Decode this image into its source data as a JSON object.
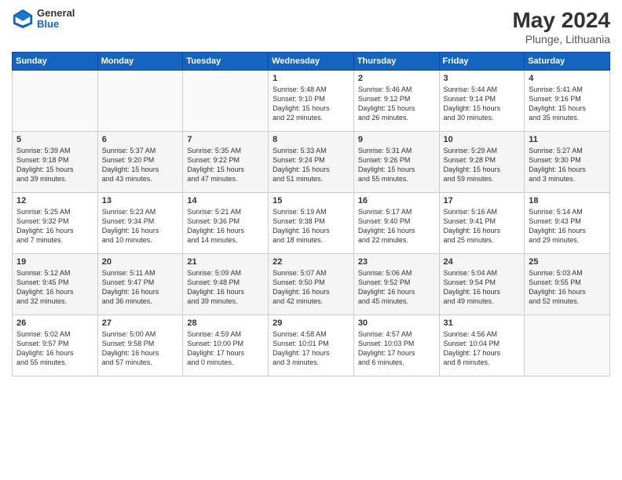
{
  "header": {
    "logo_general": "General",
    "logo_blue": "Blue",
    "month": "May 2024",
    "location": "Plunge, Lithuania"
  },
  "weekdays": [
    "Sunday",
    "Monday",
    "Tuesday",
    "Wednesday",
    "Thursday",
    "Friday",
    "Saturday"
  ],
  "weeks": [
    [
      {
        "day": "",
        "info": ""
      },
      {
        "day": "",
        "info": ""
      },
      {
        "day": "",
        "info": ""
      },
      {
        "day": "1",
        "info": "Sunrise: 5:48 AM\nSunset: 9:10 PM\nDaylight: 15 hours\nand 22 minutes."
      },
      {
        "day": "2",
        "info": "Sunrise: 5:46 AM\nSunset: 9:12 PM\nDaylight: 15 hours\nand 26 minutes."
      },
      {
        "day": "3",
        "info": "Sunrise: 5:44 AM\nSunset: 9:14 PM\nDaylight: 15 hours\nand 30 minutes."
      },
      {
        "day": "4",
        "info": "Sunrise: 5:41 AM\nSunset: 9:16 PM\nDaylight: 15 hours\nand 35 minutes."
      }
    ],
    [
      {
        "day": "5",
        "info": "Sunrise: 5:39 AM\nSunset: 9:18 PM\nDaylight: 15 hours\nand 39 minutes."
      },
      {
        "day": "6",
        "info": "Sunrise: 5:37 AM\nSunset: 9:20 PM\nDaylight: 15 hours\nand 43 minutes."
      },
      {
        "day": "7",
        "info": "Sunrise: 5:35 AM\nSunset: 9:22 PM\nDaylight: 15 hours\nand 47 minutes."
      },
      {
        "day": "8",
        "info": "Sunrise: 5:33 AM\nSunset: 9:24 PM\nDaylight: 15 hours\nand 51 minutes."
      },
      {
        "day": "9",
        "info": "Sunrise: 5:31 AM\nSunset: 9:26 PM\nDaylight: 15 hours\nand 55 minutes."
      },
      {
        "day": "10",
        "info": "Sunrise: 5:29 AM\nSunset: 9:28 PM\nDaylight: 15 hours\nand 59 minutes."
      },
      {
        "day": "11",
        "info": "Sunrise: 5:27 AM\nSunset: 9:30 PM\nDaylight: 16 hours\nand 3 minutes."
      }
    ],
    [
      {
        "day": "12",
        "info": "Sunrise: 5:25 AM\nSunset: 9:32 PM\nDaylight: 16 hours\nand 7 minutes."
      },
      {
        "day": "13",
        "info": "Sunrise: 5:23 AM\nSunset: 9:34 PM\nDaylight: 16 hours\nand 10 minutes."
      },
      {
        "day": "14",
        "info": "Sunrise: 5:21 AM\nSunset: 9:36 PM\nDaylight: 16 hours\nand 14 minutes."
      },
      {
        "day": "15",
        "info": "Sunrise: 5:19 AM\nSunset: 9:38 PM\nDaylight: 16 hours\nand 18 minutes."
      },
      {
        "day": "16",
        "info": "Sunrise: 5:17 AM\nSunset: 9:40 PM\nDaylight: 16 hours\nand 22 minutes."
      },
      {
        "day": "17",
        "info": "Sunrise: 5:16 AM\nSunset: 9:41 PM\nDaylight: 16 hours\nand 25 minutes."
      },
      {
        "day": "18",
        "info": "Sunrise: 5:14 AM\nSunset: 9:43 PM\nDaylight: 16 hours\nand 29 minutes."
      }
    ],
    [
      {
        "day": "19",
        "info": "Sunrise: 5:12 AM\nSunset: 9:45 PM\nDaylight: 16 hours\nand 32 minutes."
      },
      {
        "day": "20",
        "info": "Sunrise: 5:11 AM\nSunset: 9:47 PM\nDaylight: 16 hours\nand 36 minutes."
      },
      {
        "day": "21",
        "info": "Sunrise: 5:09 AM\nSunset: 9:48 PM\nDaylight: 16 hours\nand 39 minutes."
      },
      {
        "day": "22",
        "info": "Sunrise: 5:07 AM\nSunset: 9:50 PM\nDaylight: 16 hours\nand 42 minutes."
      },
      {
        "day": "23",
        "info": "Sunrise: 5:06 AM\nSunset: 9:52 PM\nDaylight: 16 hours\nand 45 minutes."
      },
      {
        "day": "24",
        "info": "Sunrise: 5:04 AM\nSunset: 9:54 PM\nDaylight: 16 hours\nand 49 minutes."
      },
      {
        "day": "25",
        "info": "Sunrise: 5:03 AM\nSunset: 9:55 PM\nDaylight: 16 hours\nand 52 minutes."
      }
    ],
    [
      {
        "day": "26",
        "info": "Sunrise: 5:02 AM\nSunset: 9:57 PM\nDaylight: 16 hours\nand 55 minutes."
      },
      {
        "day": "27",
        "info": "Sunrise: 5:00 AM\nSunset: 9:58 PM\nDaylight: 16 hours\nand 57 minutes."
      },
      {
        "day": "28",
        "info": "Sunrise: 4:59 AM\nSunset: 10:00 PM\nDaylight: 17 hours\nand 0 minutes."
      },
      {
        "day": "29",
        "info": "Sunrise: 4:58 AM\nSunset: 10:01 PM\nDaylight: 17 hours\nand 3 minutes."
      },
      {
        "day": "30",
        "info": "Sunrise: 4:57 AM\nSunset: 10:03 PM\nDaylight: 17 hours\nand 6 minutes."
      },
      {
        "day": "31",
        "info": "Sunrise: 4:56 AM\nSunset: 10:04 PM\nDaylight: 17 hours\nand 8 minutes."
      },
      {
        "day": "",
        "info": ""
      }
    ]
  ]
}
